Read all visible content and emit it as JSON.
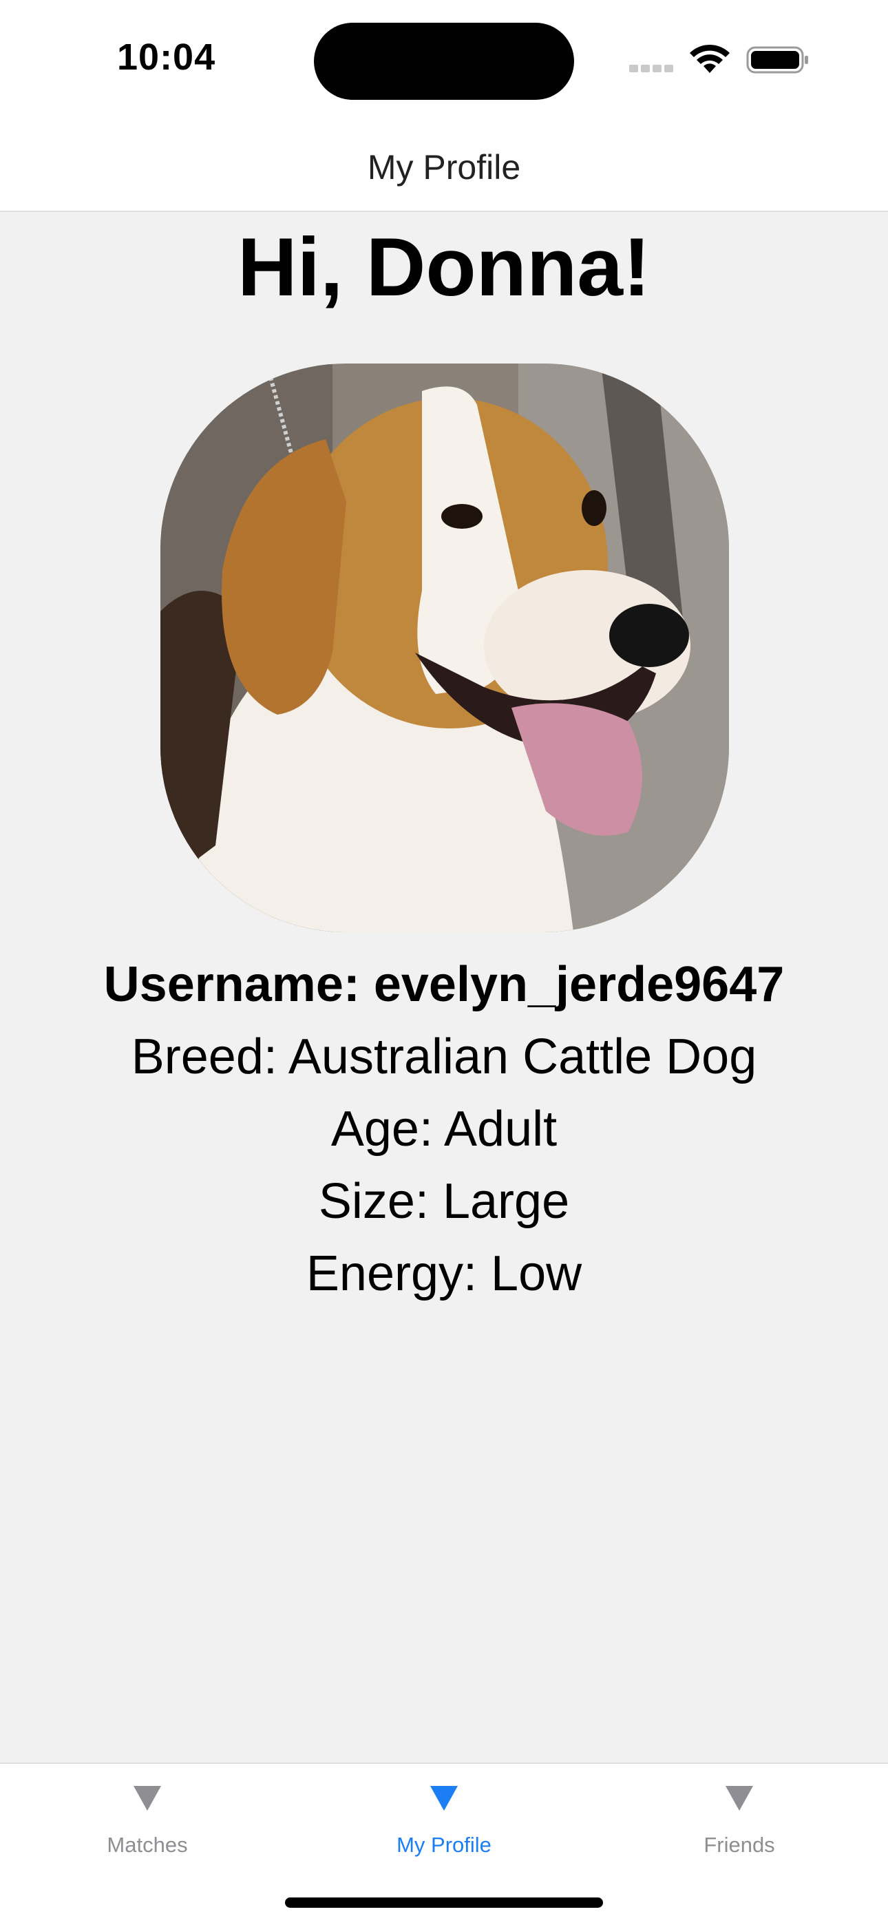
{
  "status_bar": {
    "time": "10:04",
    "icons": [
      "cellular-signal-icon",
      "wifi-icon",
      "battery-icon"
    ]
  },
  "nav": {
    "title": "My Profile"
  },
  "profile": {
    "greeting": "Hi, Donna!",
    "photo_icon": "dog-photo",
    "username": "Username: evelyn_jerde9647",
    "breed": "Breed: Australian Cattle Dog",
    "age": "Age: Adult",
    "size": "Size: Large",
    "energy": "Energy: Low"
  },
  "tab_bar": {
    "tabs": [
      {
        "label": "Matches",
        "icon": "triangle-down-icon",
        "active": false
      },
      {
        "label": "My Profile",
        "icon": "triangle-down-icon",
        "active": true
      },
      {
        "label": "Friends",
        "icon": "triangle-down-icon",
        "active": false
      }
    ],
    "active_color": "#1b7ef5",
    "inactive_color": "#8e8e93"
  },
  "colors": {
    "background": "#f1f1f1",
    "bars": "#ffffff"
  }
}
